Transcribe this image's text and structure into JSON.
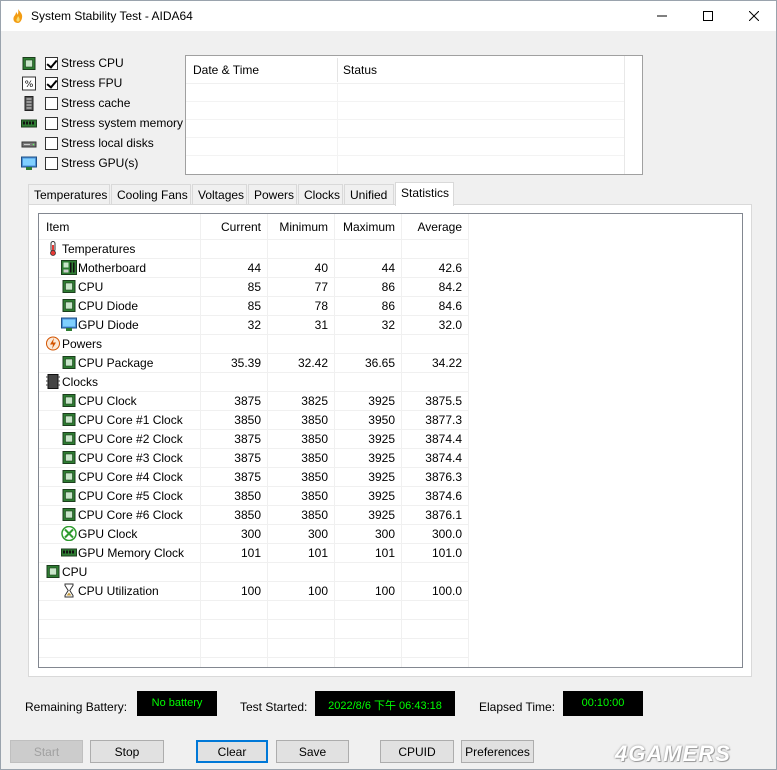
{
  "window": {
    "title": "System Stability Test - AIDA64"
  },
  "stress": [
    {
      "label": "Stress CPU",
      "checked": true,
      "icon": "cpu-chip-icon"
    },
    {
      "label": "Stress FPU",
      "checked": true,
      "icon": "fpu-icon"
    },
    {
      "label": "Stress cache",
      "checked": false,
      "icon": "cache-icon"
    },
    {
      "label": "Stress system memory",
      "checked": false,
      "icon": "memory-icon"
    },
    {
      "label": "Stress local disks",
      "checked": false,
      "icon": "disk-icon"
    },
    {
      "label": "Stress GPU(s)",
      "checked": false,
      "icon": "gpu-icon"
    }
  ],
  "log": {
    "col_datetime": "Date & Time",
    "col_status": "Status"
  },
  "tabs": [
    {
      "label": "Temperatures",
      "active": false
    },
    {
      "label": "Cooling Fans",
      "active": false
    },
    {
      "label": "Voltages",
      "active": false
    },
    {
      "label": "Powers",
      "active": false
    },
    {
      "label": "Clocks",
      "active": false
    },
    {
      "label": "Unified",
      "active": false
    },
    {
      "label": "Statistics",
      "active": true
    }
  ],
  "stats": {
    "headers": {
      "item": "Item",
      "current": "Current",
      "minimum": "Minimum",
      "maximum": "Maximum",
      "average": "Average"
    },
    "rows": [
      {
        "type": "group",
        "label": "Temperatures",
        "icon": "thermometer-icon"
      },
      {
        "type": "item",
        "label": "Motherboard",
        "icon": "motherboard-icon",
        "current": "44",
        "minimum": "40",
        "maximum": "44",
        "average": "42.6"
      },
      {
        "type": "item",
        "label": "CPU",
        "icon": "cpu-chip-icon",
        "current": "85",
        "minimum": "77",
        "maximum": "86",
        "average": "84.2"
      },
      {
        "type": "item",
        "label": "CPU Diode",
        "icon": "cpu-chip-icon",
        "current": "85",
        "minimum": "78",
        "maximum": "86",
        "average": "84.6"
      },
      {
        "type": "item",
        "label": "GPU Diode",
        "icon": "gpu-icon",
        "current": "32",
        "minimum": "31",
        "maximum": "32",
        "average": "32.0"
      },
      {
        "type": "group",
        "label": "Powers",
        "icon": "power-icon"
      },
      {
        "type": "item",
        "label": "CPU Package",
        "icon": "cpu-chip-icon",
        "current": "35.39",
        "minimum": "32.42",
        "maximum": "36.65",
        "average": "34.22"
      },
      {
        "type": "group",
        "label": "Clocks",
        "icon": "clock-chip-icon"
      },
      {
        "type": "item",
        "label": "CPU Clock",
        "icon": "cpu-chip-icon",
        "current": "3875",
        "minimum": "3825",
        "maximum": "3925",
        "average": "3875.5"
      },
      {
        "type": "item",
        "label": "CPU Core #1 Clock",
        "icon": "cpu-chip-icon",
        "current": "3850",
        "minimum": "3850",
        "maximum": "3950",
        "average": "3877.3"
      },
      {
        "type": "item",
        "label": "CPU Core #2 Clock",
        "icon": "cpu-chip-icon",
        "current": "3875",
        "minimum": "3850",
        "maximum": "3925",
        "average": "3874.4"
      },
      {
        "type": "item",
        "label": "CPU Core #3 Clock",
        "icon": "cpu-chip-icon",
        "current": "3875",
        "minimum": "3850",
        "maximum": "3925",
        "average": "3874.4"
      },
      {
        "type": "item",
        "label": "CPU Core #4 Clock",
        "icon": "cpu-chip-icon",
        "current": "3875",
        "minimum": "3850",
        "maximum": "3925",
        "average": "3876.3"
      },
      {
        "type": "item",
        "label": "CPU Core #5 Clock",
        "icon": "cpu-chip-icon",
        "current": "3850",
        "minimum": "3850",
        "maximum": "3925",
        "average": "3874.6"
      },
      {
        "type": "item",
        "label": "CPU Core #6 Clock",
        "icon": "cpu-chip-icon",
        "current": "3850",
        "minimum": "3850",
        "maximum": "3925",
        "average": "3876.1"
      },
      {
        "type": "item",
        "label": "GPU Clock",
        "icon": "xbox-icon",
        "current": "300",
        "minimum": "300",
        "maximum": "300",
        "average": "300.0"
      },
      {
        "type": "item",
        "label": "GPU Memory Clock",
        "icon": "memory-icon",
        "current": "101",
        "minimum": "101",
        "maximum": "101",
        "average": "101.0"
      },
      {
        "type": "group",
        "label": "CPU",
        "icon": "cpu-chip-icon"
      },
      {
        "type": "item",
        "label": "CPU Utilization",
        "icon": "hourglass-icon",
        "current": "100",
        "minimum": "100",
        "maximum": "100",
        "average": "100.0"
      }
    ]
  },
  "status": {
    "battery_label": "Remaining Battery:",
    "battery_value": "No battery",
    "started_label": "Test Started:",
    "started_value": "2022/8/6 下午 06:43:18",
    "elapsed_label": "Elapsed Time:",
    "elapsed_value": "00:10:00"
  },
  "buttons": {
    "start": "Start",
    "stop": "Stop",
    "clear": "Clear",
    "save": "Save",
    "cpuid": "CPUID",
    "preferences": "Preferences"
  },
  "watermark": "4GAMERS",
  "colors": {
    "lcd_bg": "#000000",
    "lcd_text": "#00ff00",
    "focus_border": "#0078d7"
  }
}
